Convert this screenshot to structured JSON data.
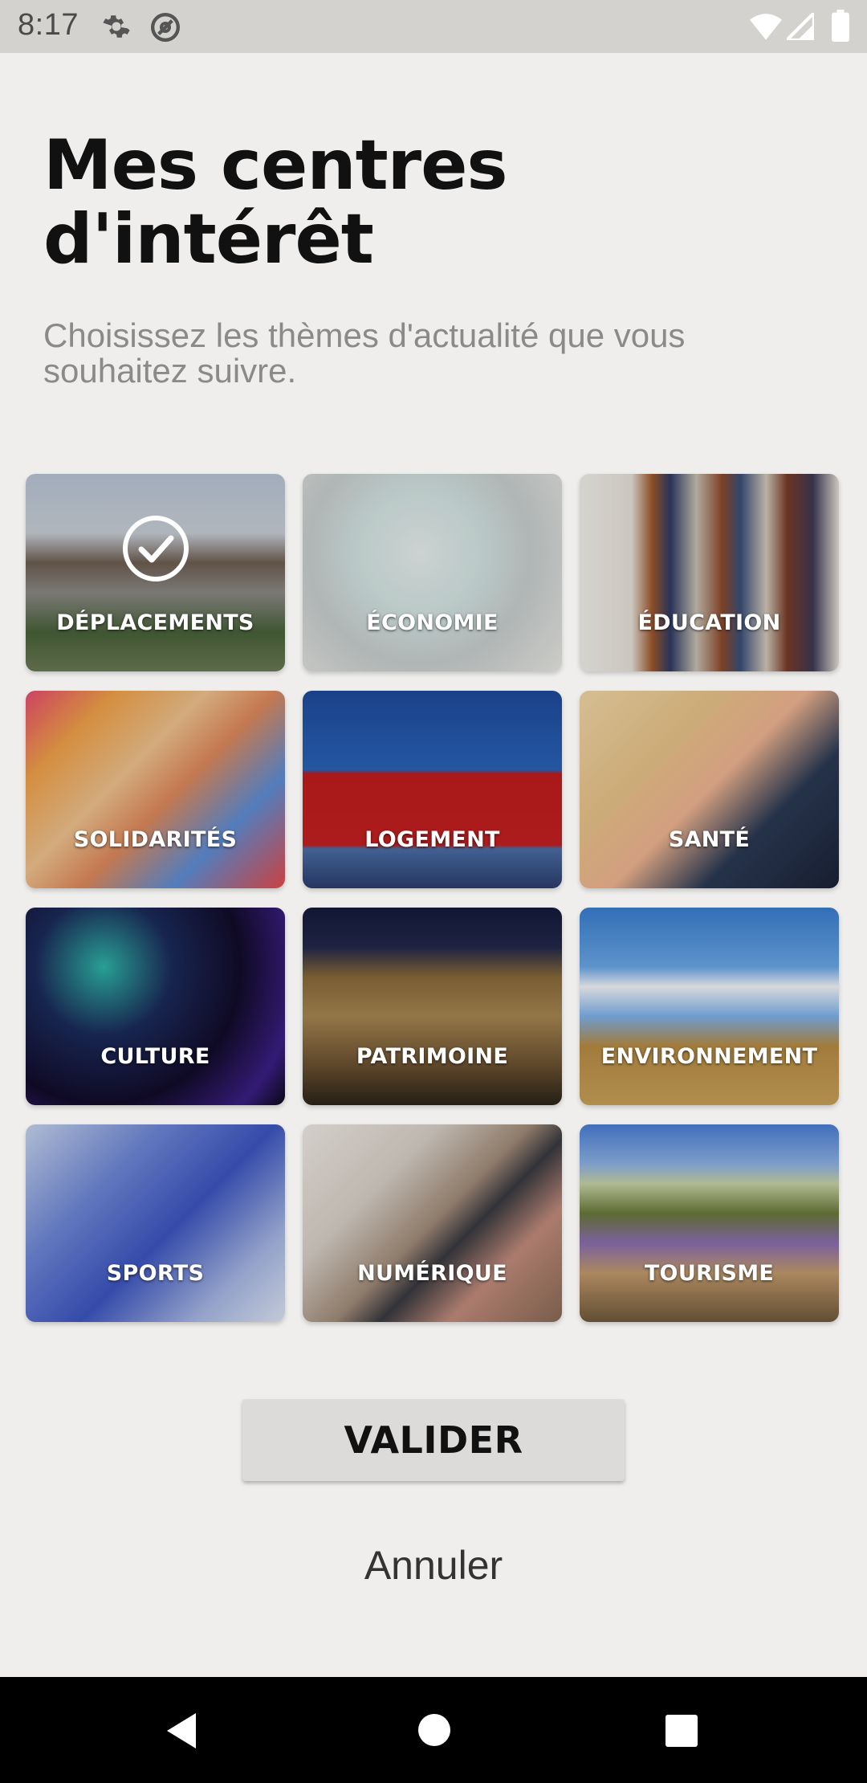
{
  "status_bar": {
    "time": "8:17",
    "icons": [
      "gear-icon",
      "at-sign-icon",
      "wifi-icon",
      "signal-icon",
      "battery-icon"
    ]
  },
  "header": {
    "title": "Mes centres d'intérêt",
    "subtitle": "Choisissez les thèmes d'actualité que vous souhaitez suivre."
  },
  "topics": [
    {
      "label": "DÉPLACEMENTS",
      "selected": true
    },
    {
      "label": "ÉCONOMIE",
      "selected": false
    },
    {
      "label": "ÉDUCATION",
      "selected": false
    },
    {
      "label": "SOLIDARITÉS",
      "selected": false
    },
    {
      "label": "LOGEMENT",
      "selected": false
    },
    {
      "label": "SANTÉ",
      "selected": false
    },
    {
      "label": "CULTURE",
      "selected": false
    },
    {
      "label": "PATRIMOINE",
      "selected": false
    },
    {
      "label": "ENVIRONNEMENT",
      "selected": false
    },
    {
      "label": "SPORTS",
      "selected": false
    },
    {
      "label": "NUMÉRIQUE",
      "selected": false
    },
    {
      "label": "TOURISME",
      "selected": false
    }
  ],
  "actions": {
    "validate_label": "VALIDER",
    "cancel_label": "Annuler"
  },
  "nav_bar": {
    "icons": [
      "back-icon",
      "home-icon",
      "recents-icon"
    ]
  }
}
